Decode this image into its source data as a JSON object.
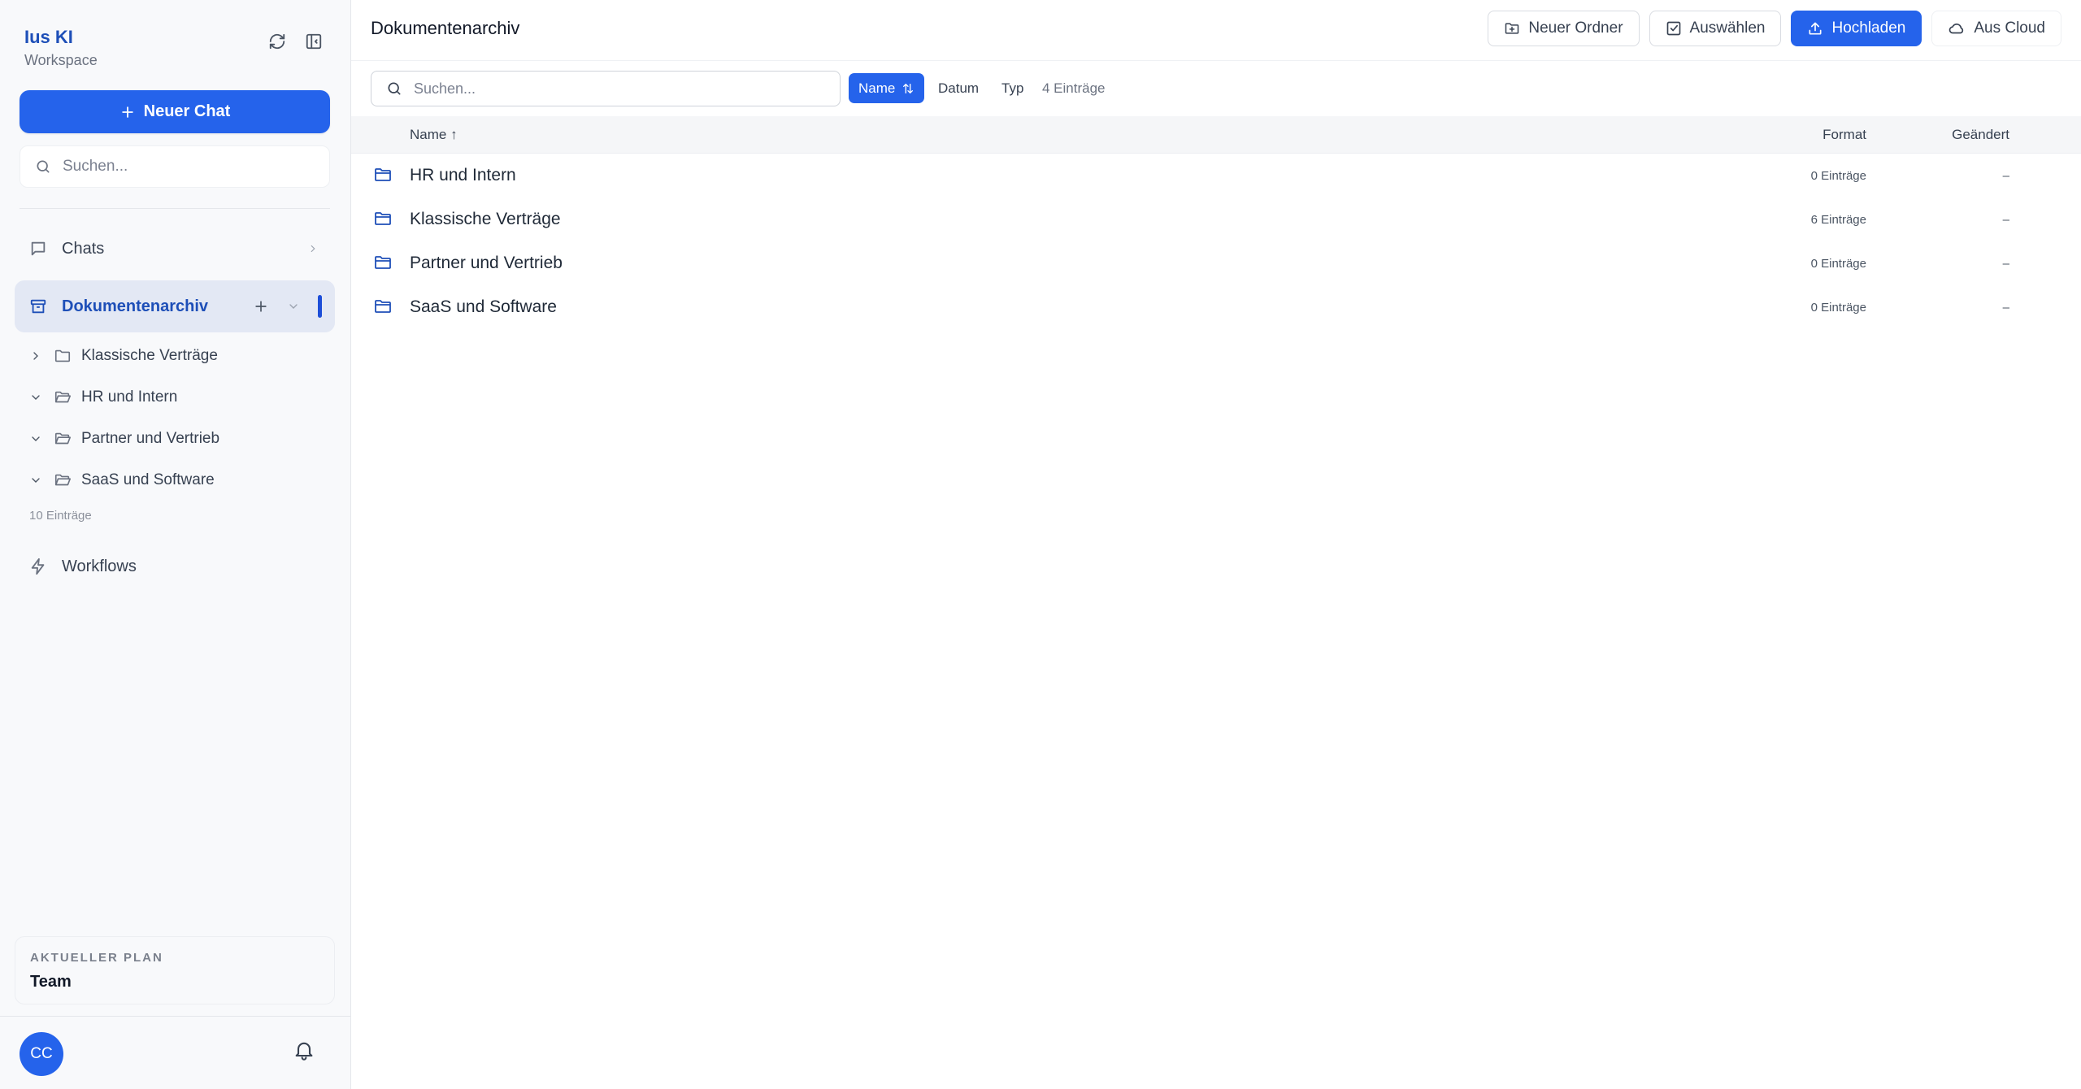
{
  "sidebar": {
    "brand_title": "Ius KI",
    "brand_subtitle": "Workspace",
    "new_chat_label": "Neuer Chat",
    "search_placeholder": "Suchen...",
    "nav": {
      "chats_label": "Chats",
      "archive_label": "Dokumentenarchiv",
      "workflows_label": "Workflows"
    },
    "tree": [
      {
        "label": "Klassische Verträge",
        "state": "collapsed"
      },
      {
        "label": "HR und Intern",
        "state": "expanded"
      },
      {
        "label": "Partner und Vertrieb",
        "state": "expanded"
      },
      {
        "label": "SaaS und Software",
        "state": "expanded"
      }
    ],
    "tree_count": "10 Einträge",
    "plan": {
      "label": "AKTUELLER PLAN",
      "value": "Team"
    },
    "avatar_initials": "CC"
  },
  "header": {
    "title": "Dokumentenarchiv",
    "actions": {
      "new_folder": "Neuer Ordner",
      "select": "Auswählen",
      "upload": "Hochladen",
      "from_cloud": "Aus Cloud"
    }
  },
  "toolbar": {
    "search_placeholder": "Suchen...",
    "sort_name": "Name",
    "sort_date": "Datum",
    "sort_type": "Typ",
    "entry_count": "4 Einträge"
  },
  "table": {
    "columns": {
      "name": "Name ↑",
      "format": "Format",
      "changed": "Geändert"
    },
    "rows": [
      {
        "name": "HR und Intern",
        "format": "0 Einträge",
        "changed": "–"
      },
      {
        "name": "Klassische Verträge",
        "format": "6 Einträge",
        "changed": "–"
      },
      {
        "name": "Partner und Vertrieb",
        "format": "0 Einträge",
        "changed": "–"
      },
      {
        "name": "SaaS und Software",
        "format": "0 Einträge",
        "changed": "–"
      }
    ]
  },
  "colors": {
    "accent": "#2563eb",
    "brand_text": "#1e4fb8",
    "sidebar_bg": "#f8f9fb",
    "active_nav_bg": "#e3e8f4"
  }
}
